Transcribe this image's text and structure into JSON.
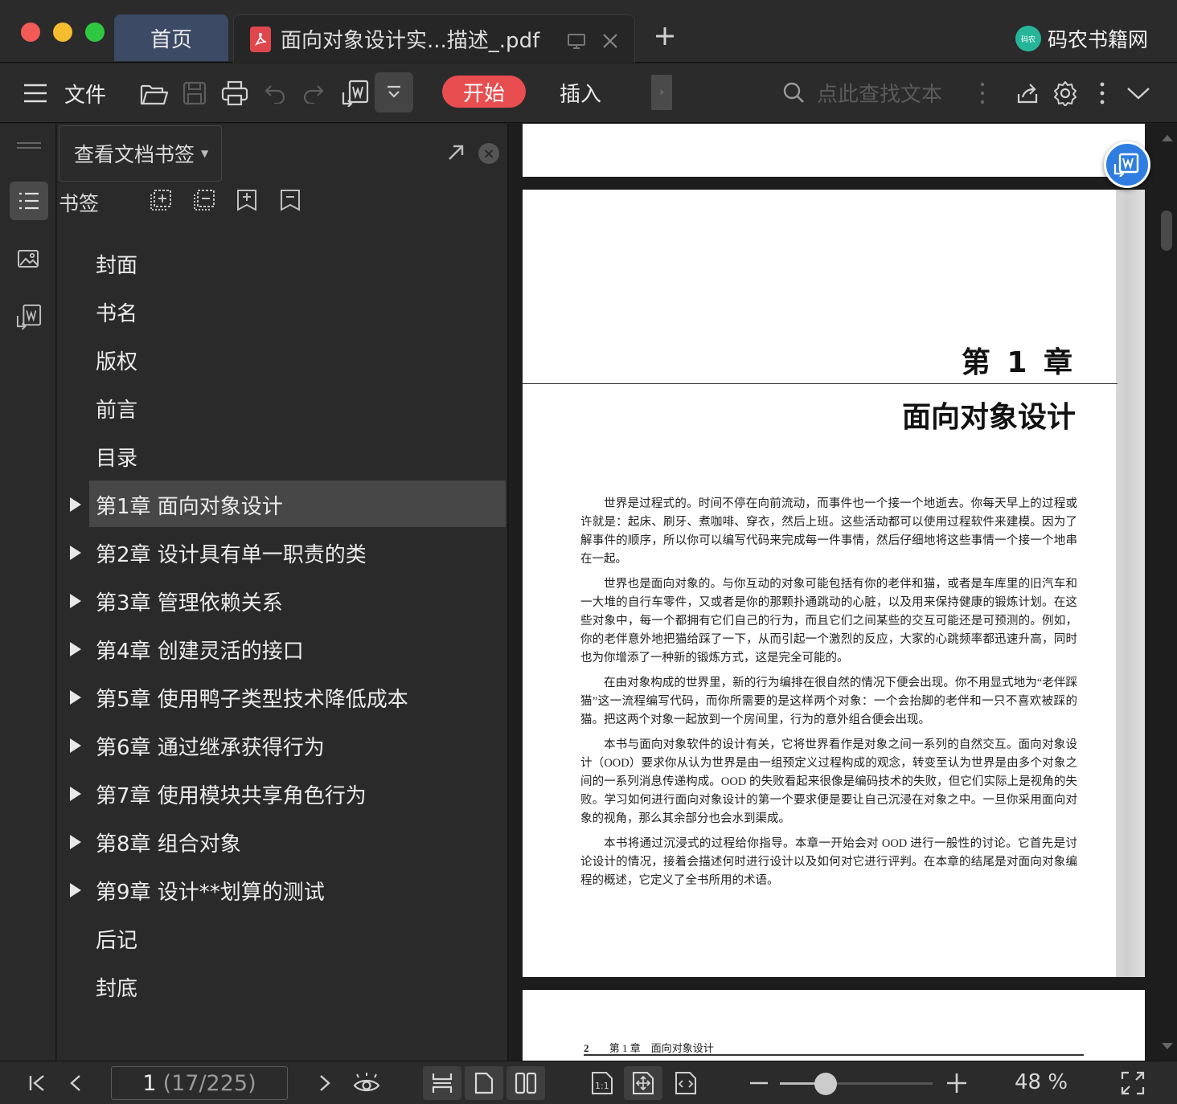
{
  "window": {
    "traffic_lights": {
      "close": "#f25a55",
      "minimize": "#f5bc2f",
      "maximize": "#2fc842"
    }
  },
  "tabs": {
    "home_label": "首页",
    "document_label": "面向对象设计实...描述_.pdf"
  },
  "brand": {
    "logo_text": "码农",
    "name": "码农书籍网"
  },
  "toolbar": {
    "menu_label": "文件",
    "start_label": "开始",
    "insert_label": "插入",
    "search_placeholder": "点此查找文本",
    "start_color": "#e84d4f"
  },
  "panel": {
    "selector_label": "查看文档书签",
    "bookmarks_title": "书签",
    "items": [
      {
        "label": "封面",
        "expandable": false
      },
      {
        "label": "书名",
        "expandable": false
      },
      {
        "label": "版权",
        "expandable": false
      },
      {
        "label": "前言",
        "expandable": false
      },
      {
        "label": "目录",
        "expandable": false
      },
      {
        "label": "第1章 面向对象设计",
        "expandable": true,
        "selected": true
      },
      {
        "label": "第2章 设计具有单一职责的类",
        "expandable": true
      },
      {
        "label": "第3章 管理依赖关系",
        "expandable": true
      },
      {
        "label": "第4章 创建灵活的接口",
        "expandable": true
      },
      {
        "label": "第5章 使用鸭子类型技术降低成本",
        "expandable": true
      },
      {
        "label": "第6章 通过继承获得行为",
        "expandable": true
      },
      {
        "label": "第7章 使用模块共享角色行为",
        "expandable": true
      },
      {
        "label": "第8章 组合对象",
        "expandable": true
      },
      {
        "label": "第9章 设计**划算的测试",
        "expandable": true
      },
      {
        "label": "后记",
        "expandable": false
      },
      {
        "label": "封底",
        "expandable": false
      }
    ]
  },
  "document": {
    "chapter_number": "第 1 章",
    "chapter_title": "面向对象设计",
    "paragraphs": [
      "世界是过程式的。时间不停在向前流动，而事件也一个接一个地逝去。你每天早上的过程或许就是：起床、刷牙、煮咖啡、穿衣，然后上班。这些活动都可以使用过程软件来建模。因为了解事件的顺序，所以你可以编写代码来完成每一件事情，然后仔细地将这些事情一个接一个地串在一起。",
      "世界也是面向对象的。与你互动的对象可能包括有你的老伴和猫，或者是车库里的旧汽车和一大堆的自行车零件，又或者是你的那颗扑通跳动的心脏，以及用来保持健康的锻炼计划。在这些对象中，每一个都拥有它们自己的行为，而且它们之间某些的交互可能还是可预测的。例如，你的老伴意外地把猫给踩了一下，从而引起一个激烈的反应，大家的心跳频率都迅速升高，同时也为你增添了一种新的锻炼方式，这是完全可能的。",
      "在由对象构成的世界里，新的行为编排在很自然的情况下便会出现。你不用显式地为“老伴踩猫”这一流程编写代码，而你所需要的是这样两个对象：一个会抬脚的老伴和一只不喜欢被踩的猫。把这两个对象一起放到一个房间里，行为的意外组合便会出现。",
      "本书与面向对象软件的设计有关，它将世界看作是对象之间一系列的自然交互。面向对象设计（OOD）要求你从认为世界是由一组预定义过程构成的观念，转变至认为世界是由多个对象之间的一系列消息传递构成。OOD 的失败看起来很像是编码技术的失败，但它们实际上是视角的失败。学习如何进行面向对象设计的第一个要求便是要让自己沉浸在对象之中。一旦你采用面向对象的视角，那么其余部分也会水到渠成。",
      "本书将通过沉浸式的过程给你指导。本章一开始会对 OOD 进行一般性的讨论。它首先是讨论设计的情况，接着会描述何时进行设计以及如何对它进行评判。在本章的结尾是对面向对象编程的概述，它定义了全书所用的术语。"
    ],
    "next_page_number": "2",
    "next_page_header": "第 1 章　面向对象设计"
  },
  "statusbar": {
    "page_current": "1",
    "page_total": "(17/225)",
    "zoom_label": "48 %",
    "zoom_level": 0.3
  }
}
